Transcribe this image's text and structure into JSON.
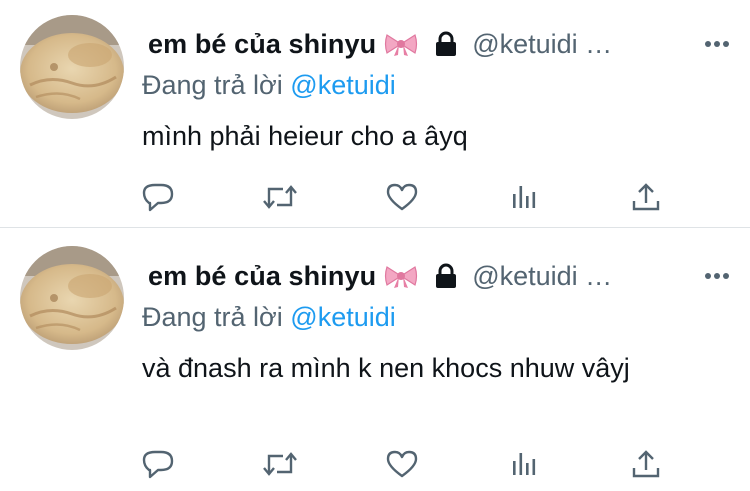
{
  "colors": {
    "link": "#1d9bf0",
    "muted": "#536471",
    "text": "#0f1419"
  },
  "tweets": [
    {
      "display_name": "em bé của shinyu",
      "handle": "@ketuidi …",
      "reply_prefix": "Đang trả lời",
      "reply_to": "@ketuidi",
      "text": "mình phải heieur cho a âyq",
      "icons": [
        "bow-emoji",
        "lock-icon",
        "more-icon",
        "reply-icon",
        "retweet-icon",
        "like-icon",
        "views-icon",
        "share-icon"
      ]
    },
    {
      "display_name": "em bé của shinyu",
      "handle": "@ketuidi …",
      "reply_prefix": "Đang trả lời",
      "reply_to": "@ketuidi",
      "text": "và đnash ra mình k nen khocs nhuw vâyj",
      "icons": [
        "bow-emoji",
        "lock-icon",
        "more-icon",
        "reply-icon",
        "retweet-icon",
        "like-icon",
        "views-icon",
        "share-icon"
      ]
    }
  ]
}
